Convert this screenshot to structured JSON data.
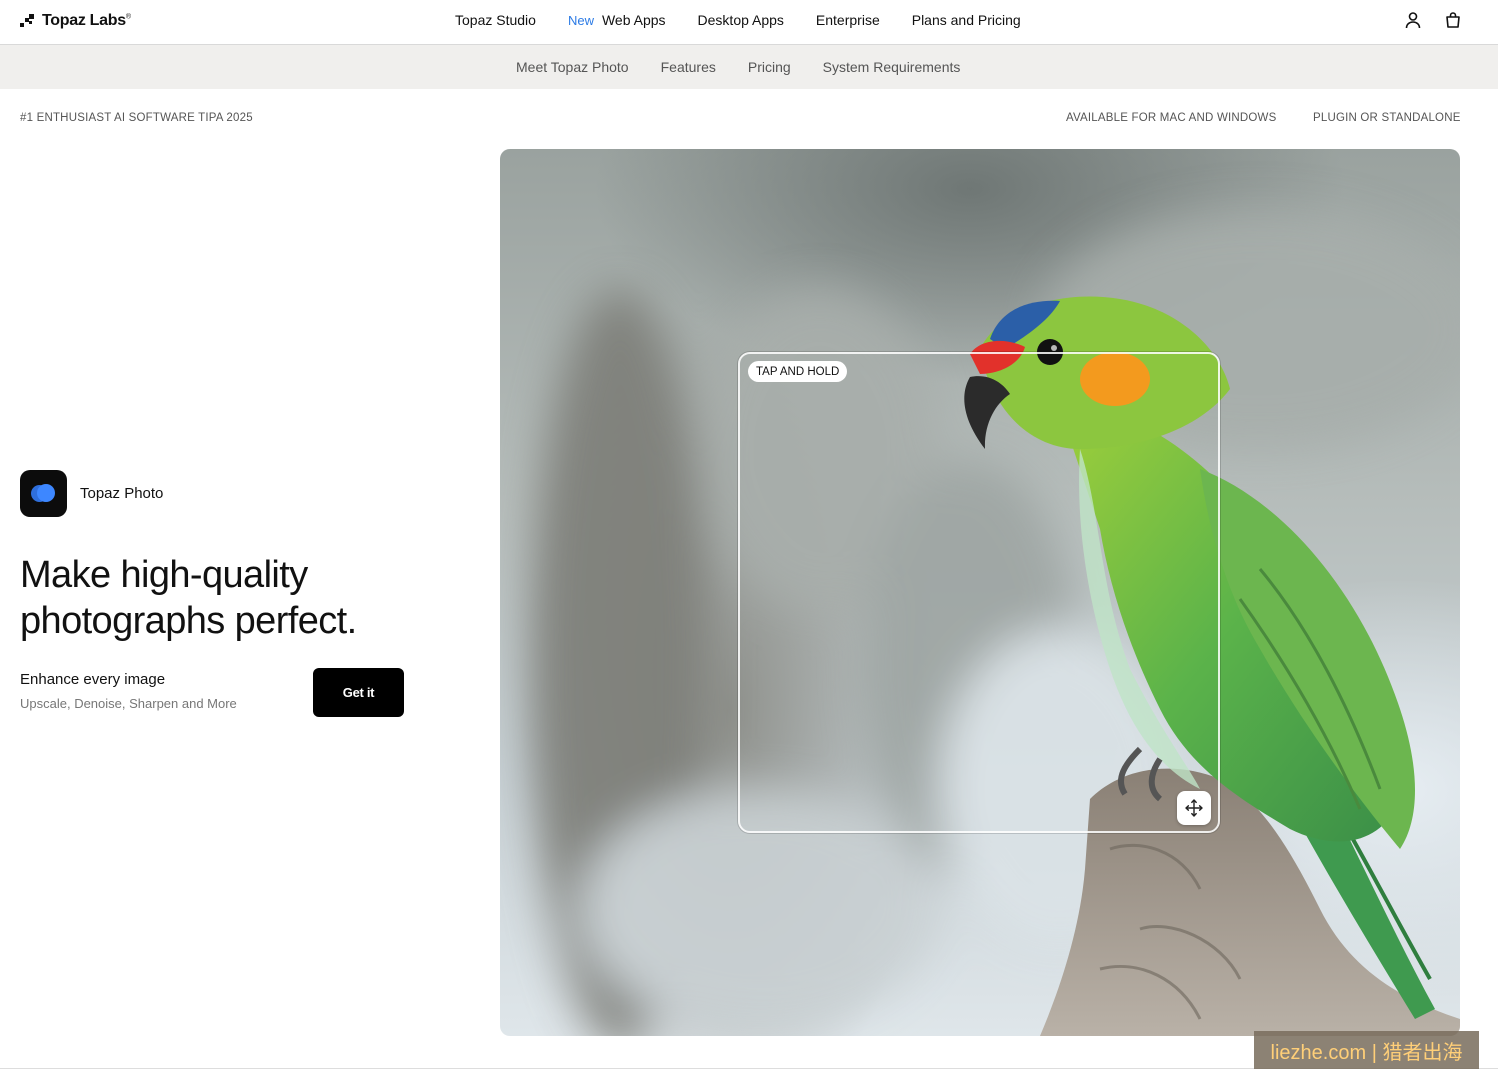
{
  "brand": {
    "name": "Topaz Labs",
    "mark": "®"
  },
  "nav": {
    "items": [
      {
        "label": "Topaz Studio"
      },
      {
        "badge": "New",
        "label": "Web Apps"
      },
      {
        "label": "Desktop Apps"
      },
      {
        "label": "Enterprise"
      },
      {
        "label": "Plans and Pricing"
      }
    ],
    "icons": [
      "account-icon",
      "cart-icon"
    ]
  },
  "subnav": {
    "items": [
      "Meet Topaz Photo",
      "Features",
      "Pricing",
      "System Requirements"
    ]
  },
  "taglines": {
    "left": "#1 ENTHUSIAST AI SOFTWARE TIPA 2025",
    "platforms": "AVAILABLE FOR MAC AND WINDOWS",
    "mode": "PLUGIN OR STANDALONE"
  },
  "hero": {
    "app_name": "Topaz Photo",
    "headline": "Make high-quality photographs perfect.",
    "subtitle": "Enhance every image",
    "features": "Upscale, Denoise, Sharpen and More",
    "cta": "Get it",
    "compare_hint": "TAP AND HOLD",
    "compare_icon": "move-arrows-icon"
  },
  "watermark": "liezhe.com | 猎者出海",
  "colors": {
    "accent": "#2c7be5",
    "cta_bg": "#000000",
    "subnav_bg": "#f0efed"
  }
}
